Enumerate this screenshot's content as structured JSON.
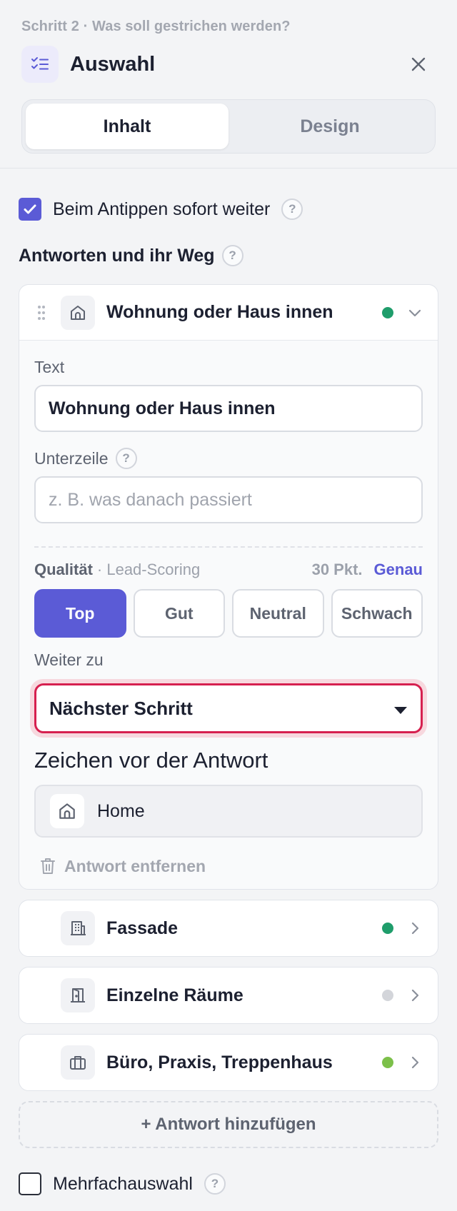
{
  "header": {
    "breadcrumb": "Schritt 2 · Was soll gestrichen werden?",
    "title": "Auswahl",
    "icon": "checklist-icon",
    "tabs": [
      {
        "label": "Inhalt",
        "active": true
      },
      {
        "label": "Design",
        "active": false
      }
    ]
  },
  "options": {
    "auto_advance_label": "Beim Antippen sofort weiter",
    "auto_advance_checked": true,
    "answers_label": "Antworten und ihr Weg",
    "multi_select_label": "Mehrfachauswahl",
    "multi_select_checked": false,
    "help_glyph": "?"
  },
  "answers": [
    {
      "title": "Wohnung oder Haus innen",
      "icon": "home-icon",
      "status_color": "#1f9d6b",
      "expanded": true,
      "text_label": "Text",
      "text_value": "Wohnung oder Haus innen",
      "subline_label": "Unterzeile",
      "subline_placeholder": "z. B. was danach passiert",
      "quality_label": "Qualität",
      "quality_sub": "· Lead-Scoring",
      "quality_points": "30 Pkt.",
      "quality_link": "Genau",
      "quality_options": [
        "Top",
        "Gut",
        "Neutral",
        "Schwach"
      ],
      "quality_selected": "Top",
      "next_label": "Weiter zu",
      "next_value": "Nächster Schritt",
      "icon_label": "Zeichen vor der Antwort",
      "icon_value": "Home",
      "remove_label": "Antwort entfernen"
    },
    {
      "title": "Fassade",
      "icon": "building-icon",
      "status_color": "#1f9d6b"
    },
    {
      "title": "Einzelne Räume",
      "icon": "door-icon",
      "status_color": "#d3d5da"
    },
    {
      "title": "Büro, Praxis, Treppenhaus",
      "icon": "briefcase-icon",
      "status_color": "#7cc04a"
    }
  ],
  "add_answer_label": "+ Antwort hinzufügen",
  "colors": {
    "accent": "#5b5bd6",
    "focus_ring": "#d6204f"
  }
}
